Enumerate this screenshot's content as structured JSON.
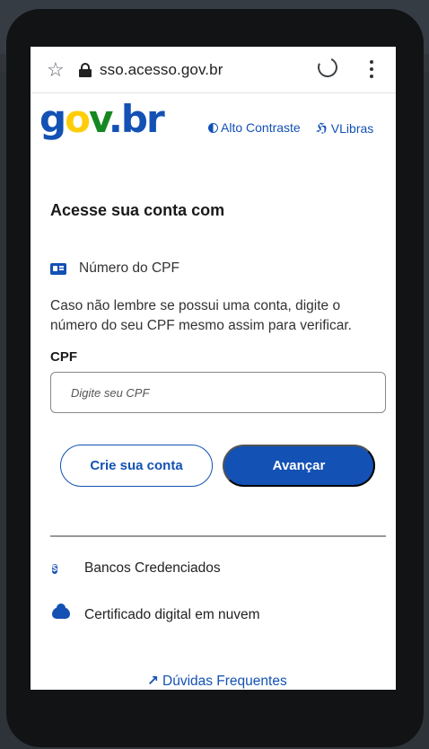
{
  "browser": {
    "url": "sso.acesso.gov.br"
  },
  "header": {
    "logo_parts": {
      "g": "g",
      "o": "o",
      "v": "v",
      "dot": ".",
      "b": "b",
      "r": "r"
    },
    "contrast_label": "Alto Contraste",
    "vlibras_label": "VLibras"
  },
  "login": {
    "title": "Acesse sua conta com",
    "method_label": "Número do CPF",
    "help_text": "Caso não lembre se possui uma conta, digite o número do seu CPF mesmo assim para verificar.",
    "cpf_label": "CPF",
    "cpf_placeholder": "Digite seu CPF",
    "create_button": "Crie sua conta",
    "next_button": "Avançar"
  },
  "links": {
    "banks": "Bancos Credenciados",
    "cloud_cert": "Certificado digital em nuvem",
    "faq": "Dúvidas Frequentes"
  },
  "colors": {
    "primary": "#1351b4",
    "logo_yellow": "#ffcd07",
    "logo_green": "#168821"
  }
}
